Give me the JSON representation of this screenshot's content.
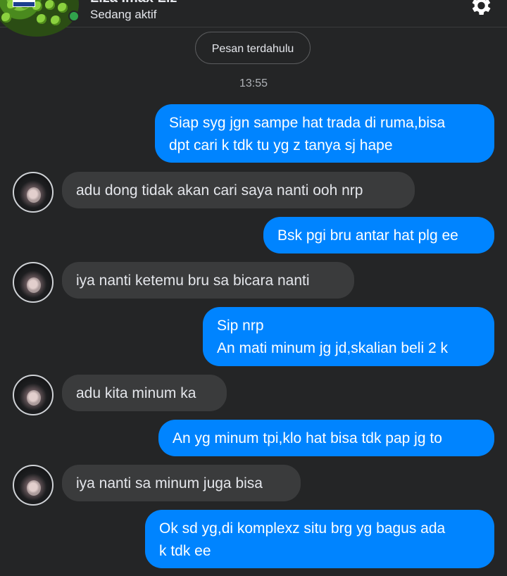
{
  "header": {
    "contact_name": "Liza Imax Liz",
    "status": "Sedang aktif",
    "settings_icon": "gear-icon"
  },
  "conversation": {
    "older_messages_label": "Pesan terdahulu",
    "timestamp": "13:55",
    "messages": [
      {
        "direction": "outgoing",
        "text": "Siap syg jgn sampe hat trada di ruma,bisa\ndpt cari k tdk tu yg z tanya sj hape"
      },
      {
        "direction": "incoming",
        "text": "adu dong tidak akan cari saya nanti ooh nrp"
      },
      {
        "direction": "outgoing",
        "text": "Bsk pgi bru antar hat plg ee"
      },
      {
        "direction": "incoming",
        "text": "iya nanti ketemu bru sa bicara nanti"
      },
      {
        "direction": "outgoing",
        "text": "Sip nrp\nAn mati minum jg jd,skalian beli 2 k"
      },
      {
        "direction": "incoming",
        "text": "adu kita minum ka"
      },
      {
        "direction": "outgoing",
        "text": "An yg minum tpi,klo hat bisa tdk pap jg to"
      },
      {
        "direction": "incoming",
        "text": "iya nanti sa minum juga bisa"
      },
      {
        "direction": "outgoing",
        "text": "Ok sd yg,di komplexz situ brg yg bagus ada\nk tdk ee"
      }
    ]
  },
  "colors": {
    "background": "#242526",
    "outgoing_bubble": "#0084ff",
    "incoming_bubble": "#3a3b3c",
    "online": "#31a24c"
  }
}
